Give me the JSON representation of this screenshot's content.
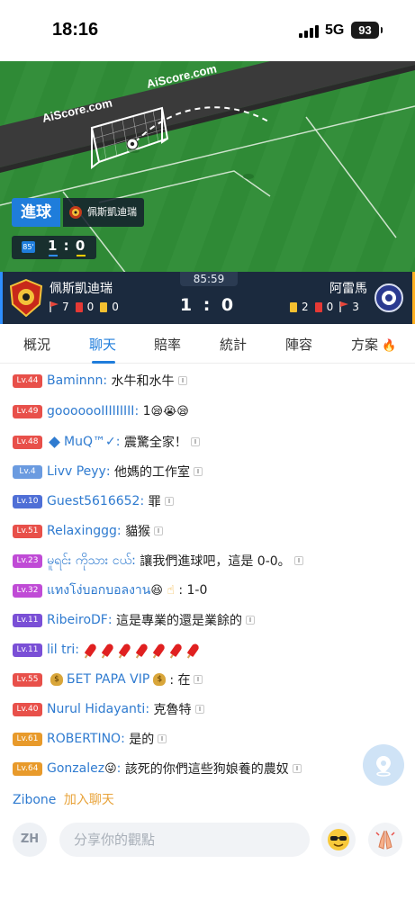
{
  "status_bar": {
    "time": "18:16",
    "network": "5G",
    "battery": "93"
  },
  "pitch": {
    "watermark": "AiScore.com",
    "goal_label": "進球",
    "goal_team": "佩斯凱迪瑞",
    "minute": "85'",
    "score_home": "1",
    "score_sep": ":",
    "score_away": "0"
  },
  "match": {
    "clock": "85:59",
    "home_name": "佩斯凱迪瑞",
    "away_name": "阿雷馬",
    "score": "1 : 0",
    "home_stats": {
      "corners": "7",
      "red": "0",
      "yellow": "0"
    },
    "away_stats": {
      "yellow": "2",
      "red": "0",
      "corners": "3"
    }
  },
  "tabs": [
    {
      "label": "概況"
    },
    {
      "label": "聊天"
    },
    {
      "label": "賠率"
    },
    {
      "label": "統計"
    },
    {
      "label": "陣容"
    },
    {
      "label": "方案"
    }
  ],
  "active_tab": "聊天",
  "colors": {
    "accent": "#1f7ddb",
    "header_bg": "#1b2a3e",
    "username": "#2f7bd0"
  },
  "chat": [
    {
      "level": "Lv.44",
      "user": "Baminnn",
      "text": "水牛和水牛",
      "badge_color": "#e8504a"
    },
    {
      "level": "Lv.49",
      "user": "gooooooIIIIIIIII",
      "text": "1",
      "badge_color": "#e8504a"
    },
    {
      "level": "Lv.48",
      "user": "MuQ™✓",
      "text": "震驚全家！",
      "badge_color": "#e8504a"
    },
    {
      "level": "Lv.4",
      "user": "Livv Peyy",
      "text": "他媽的工作室",
      "badge_color": "#6b9be0"
    },
    {
      "level": "Lv.10",
      "user": "Guest5616652",
      "text": "罪",
      "badge_color": "#4f6fd6"
    },
    {
      "level": "Lv.51",
      "user": "Relaxinggg",
      "text": "貓猴",
      "badge_color": "#e8504a"
    },
    {
      "level": "Lv.23",
      "user": "မူရင်း ကိုသား ငယ်",
      "text": "讓我們進球吧，這是 0-0。",
      "badge_color": "#c04bd6"
    },
    {
      "level": "Lv.32",
      "user": "แทงโง่บอกบอลงาน",
      "text": ": 1-0",
      "badge_color": "#c04bd6"
    },
    {
      "level": "Lv.11",
      "user": "RibeiroDF",
      "text": "這是專業的還是業餘的",
      "badge_color": "#7a4fd6"
    },
    {
      "level": "Lv.11",
      "user": "lil tri",
      "text": "",
      "badge_color": "#7a4fd6"
    },
    {
      "level": "Lv.55",
      "user": "БЕТ PAPA VIP",
      "text": ": 在",
      "badge_color": "#e8504a"
    },
    {
      "level": "Lv.40",
      "user": "Nurul Hidayanti",
      "text": "克魯特",
      "badge_color": "#e8504a"
    },
    {
      "level": "Lv.61",
      "user": "ROBERTINO",
      "text": "是的",
      "badge_color": "#e89a2b"
    },
    {
      "level": "Lv.64",
      "user": "Gonzalez",
      "text": "該死的你們這些狗娘養的農奴",
      "badge_color": "#e89a2b"
    }
  ],
  "join": {
    "user": "Zibone",
    "action": "加入聊天"
  },
  "input": {
    "lang": "ZH",
    "placeholder": "分享你的觀點"
  }
}
